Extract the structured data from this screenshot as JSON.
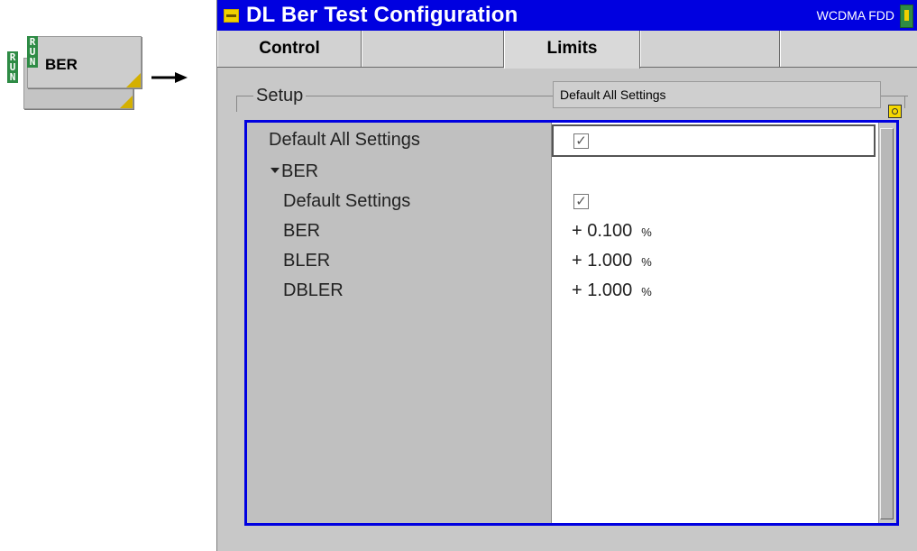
{
  "softkey": {
    "label": "BER",
    "run_tag_back": [
      "R",
      "U",
      "N"
    ],
    "run_tag_front": [
      "R",
      "U",
      "N"
    ]
  },
  "window": {
    "title": "DL Ber Test Configuration",
    "standard": "WCDMA FDD"
  },
  "tabs": [
    {
      "label": "Control",
      "active": false
    },
    {
      "label": "",
      "active": false
    },
    {
      "label": "Limits",
      "active": true
    },
    {
      "label": "",
      "active": false
    },
    {
      "label": ""
    }
  ],
  "setup": {
    "label": "Setup",
    "combo_value": "Default All Settings"
  },
  "rows": [
    {
      "label": "Default All Settings",
      "type": "checkbox",
      "checked": true
    },
    {
      "label": "BER",
      "type": "group",
      "expanded": true
    },
    {
      "label": "Default Settings",
      "type": "checkbox",
      "checked": true
    },
    {
      "label": "BER",
      "value": "+ 0.100",
      "unit": "%"
    },
    {
      "label": "BLER",
      "value": "+ 1.000",
      "unit": "%"
    },
    {
      "label": "DBLER",
      "value": "+ 1.000",
      "unit": "%"
    }
  ],
  "colors": {
    "title_bar": "#0000e0",
    "frame_border": "#0000e0",
    "run_tag": "#2e8b45",
    "accent_yellow": "#f0d000"
  }
}
